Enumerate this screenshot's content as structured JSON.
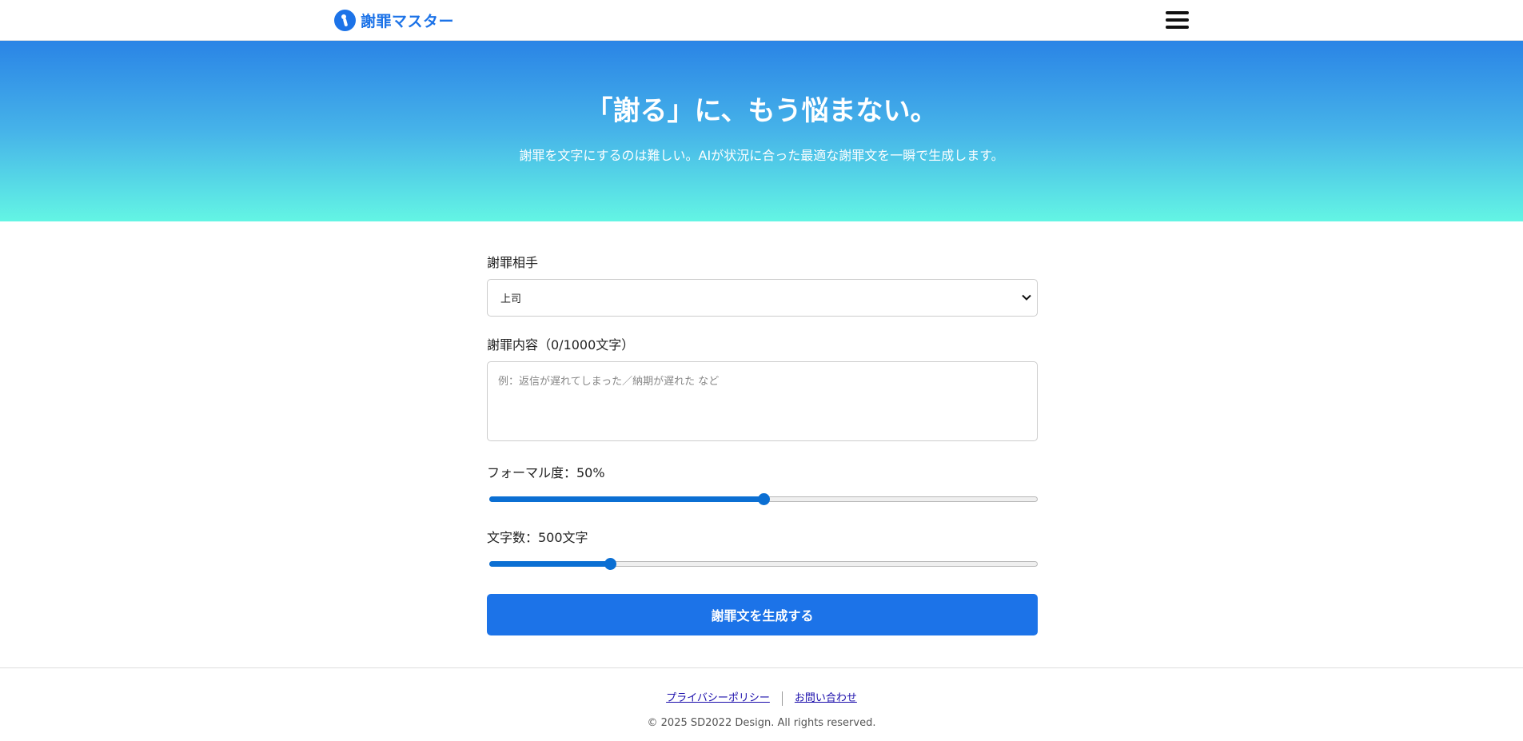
{
  "header": {
    "brand_name": "謝罪マスター",
    "brand_color": "#1c73e8"
  },
  "hero": {
    "title": "「謝る」に、もう悩まない。",
    "subtitle": "謝罪を文字にするのは難しい。AIが状況に合った最適な謝罪文を一瞬で生成します。"
  },
  "form": {
    "recipient": {
      "label": "謝罪相手",
      "selected": "上司"
    },
    "content": {
      "label": "謝罪内容（0/1000文字）",
      "placeholder": "例：返信が遅れてしまった／納期が遅れた など"
    },
    "formality": {
      "label": "フォーマル度：50%",
      "value": 50,
      "min": 0,
      "max": 100
    },
    "length": {
      "label": "文字数：500文字",
      "fraction": 0.22
    },
    "submit_label": "謝罪文を生成する"
  },
  "footer": {
    "links": [
      "プライバシーポリシー",
      "お問い合わせ"
    ],
    "copyright": "© 2025 SD2022 Design. All rights reserved."
  },
  "colors": {
    "accent": "#1c73e8",
    "slider": "#0b6fd3",
    "hero_top": "#2a84e6",
    "hero_bottom": "#63f5e4"
  }
}
